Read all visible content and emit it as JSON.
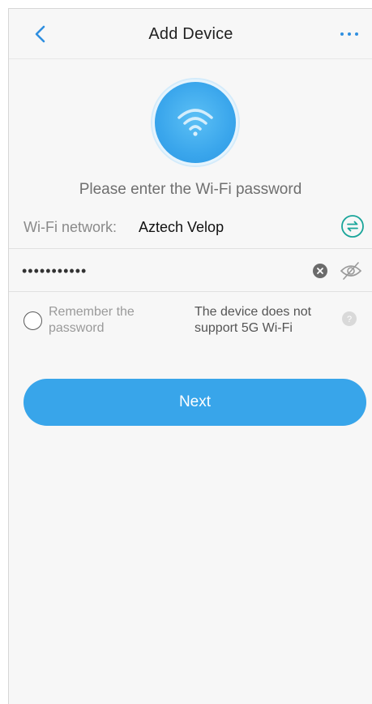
{
  "header": {
    "title": "Add Device",
    "back_icon": "chevron-left-icon",
    "more_icon": "more-horizontal-icon"
  },
  "wifi": {
    "icon": "wifi-icon",
    "prompt": "Please enter the Wi-Fi password",
    "network_label": "Wi-Fi network:",
    "network_name": "Aztech Velop",
    "switch_icon": "switch-network-icon"
  },
  "password": {
    "value": "•••••••••••",
    "clear_icon": "clear-icon",
    "visibility_icon": "eye-off-icon"
  },
  "remember": {
    "label": "Remember the password",
    "checked": false
  },
  "note": {
    "text": "The device does not support 5G Wi-Fi",
    "help_icon": "help-icon"
  },
  "actions": {
    "next_label": "Next"
  },
  "colors": {
    "accent": "#38a5ea",
    "background": "#f7f7f7",
    "back_icon": "#2f8fe0",
    "switch_icon": "#1aa59a"
  }
}
